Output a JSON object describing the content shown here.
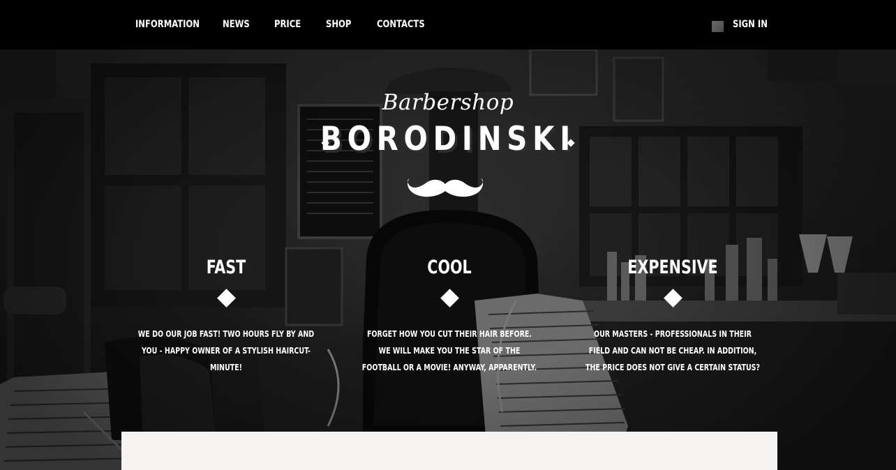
{
  "nav": {
    "items": [
      {
        "label": "INFORMATION"
      },
      {
        "label": "NEWS"
      },
      {
        "label": "PRICE"
      },
      {
        "label": "SHOP"
      },
      {
        "label": "CONTACTS"
      }
    ],
    "signin_label": "SIGN IN"
  },
  "hero": {
    "script_title": "Barbershop",
    "brand_name": "BORODINSKI"
  },
  "features": [
    {
      "title": "FAST",
      "text": "WE DO OUR JOB FAST! TWO HOURS FLY BY AND YOU - HAPPY OWNER OF A STYLISH HAIRCUT-MINUTE!"
    },
    {
      "title": "COOL",
      "text": "FORGET HOW YOU CUT THEIR HAIR BEFORE. WE WILL MAKE YOU THE STAR OF THE FOOTBALL OR A MOVIE! ANYWAY, APPARENTLY."
    },
    {
      "title": "EXPENSIVE",
      "text": "OUR MASTERS - PROFESSIONALS IN THEIR FIELD AND CAN NOT BE CHEAP. IN ADDITION, THE PRICE DOES NOT GIVE A CERTAIN STATUS?"
    }
  ],
  "colors": {
    "topbar": "#000000",
    "text": "#ffffff",
    "panel": "#f5f3f1"
  }
}
